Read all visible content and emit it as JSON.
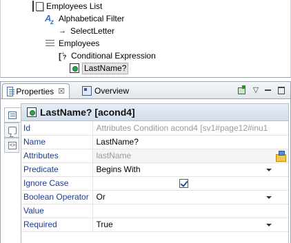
{
  "tree": {
    "items": [
      {
        "label": "Employees List",
        "icon": "list-icon"
      },
      {
        "label": "Alphabetical Filter",
        "icon": "filter-icon"
      },
      {
        "label": "SelectLetter",
        "icon": "arrow-icon"
      },
      {
        "label": "Employees",
        "icon": "lines-icon"
      },
      {
        "label": "Conditional Expression",
        "icon": "conditional-expression-icon"
      },
      {
        "label": "LastName?",
        "icon": "attribute-condition-icon",
        "selected": true
      }
    ],
    "arrow_glyph": "→"
  },
  "view": {
    "tabs": [
      {
        "label": "Properties",
        "active": true
      },
      {
        "label": "Overview",
        "active": false
      }
    ],
    "close_glyph": "☒",
    "menu_glyph": "▽"
  },
  "properties": {
    "title": "LastName? [acond4]",
    "rows": [
      {
        "key": "Id",
        "value": "Attributes Condition acond4  [sv1#page12#inu1",
        "readonly": true
      },
      {
        "key": "Name",
        "value": "LastName?"
      },
      {
        "key": "Attributes",
        "value": "lastName",
        "readonly": true
      },
      {
        "key": "Predicate",
        "value": "Begins With"
      },
      {
        "key": "Ignore Case",
        "value": "",
        "checked": true
      },
      {
        "key": "Boolean Operator",
        "value": "Or"
      },
      {
        "key": "Value",
        "value": ""
      },
      {
        "key": "Required",
        "value": "True"
      }
    ]
  },
  "colors": {
    "key_text": "#1a3c8f",
    "readonly_text": "#9a9a9a",
    "title_bg": "#d3deeb"
  }
}
